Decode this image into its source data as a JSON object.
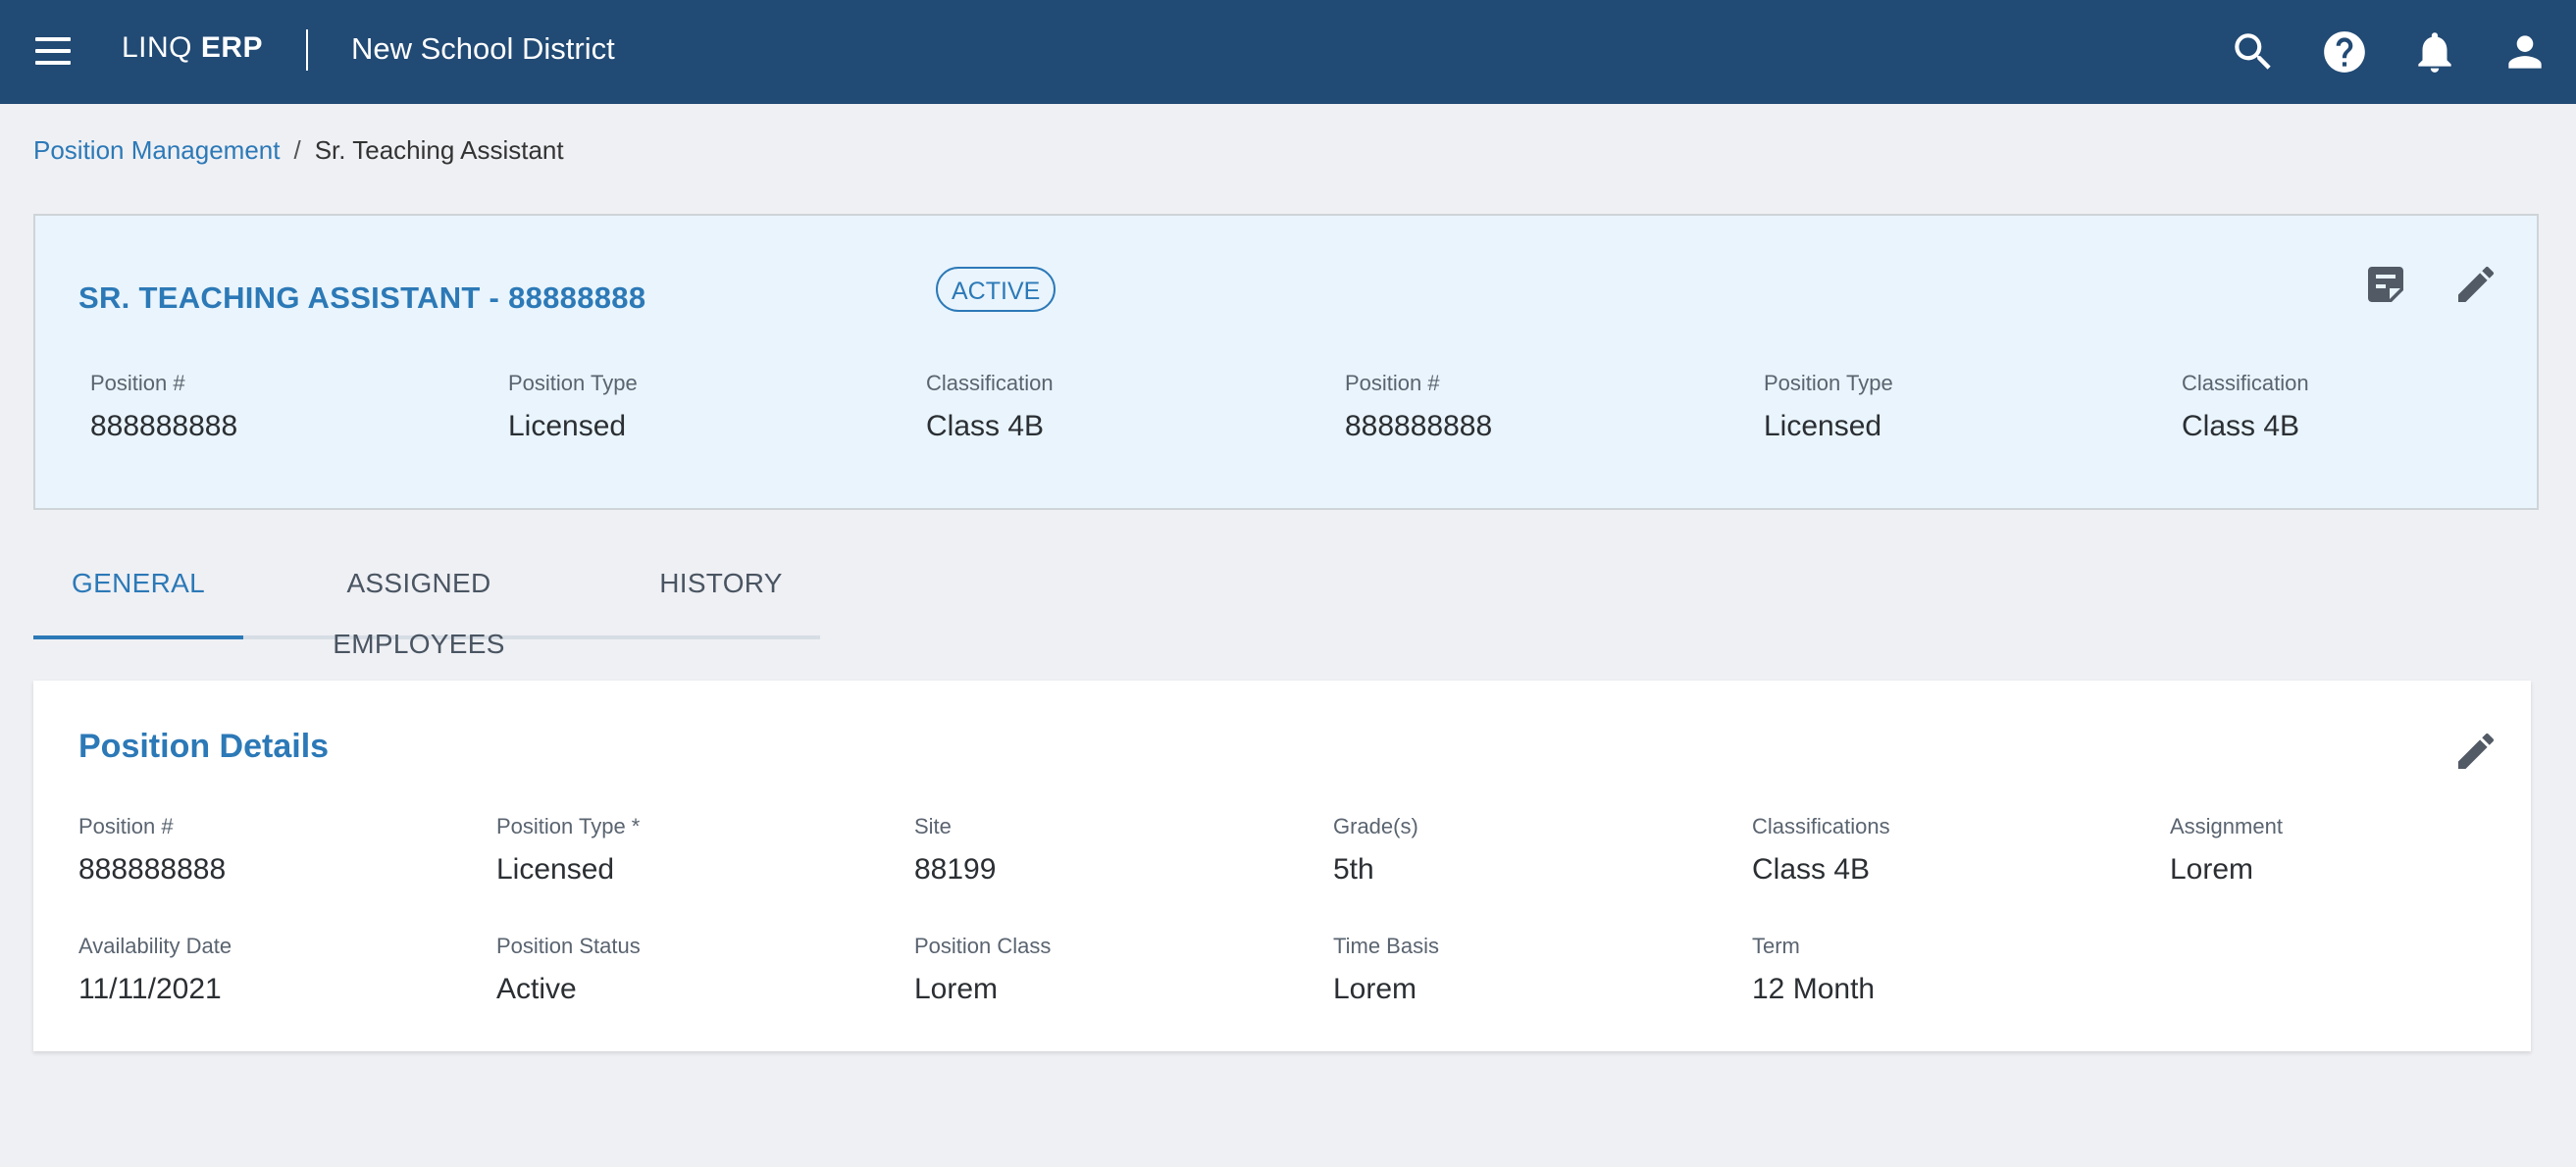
{
  "header": {
    "brand_prefix": "LINQ",
    "brand_bold": "ERP",
    "district": "New School District",
    "icons": [
      "menu-icon",
      "search-icon",
      "help-icon",
      "notifications-icon",
      "account-icon"
    ]
  },
  "breadcrumb": {
    "parent": "Position Management",
    "separator": "/",
    "current": "Sr. Teaching Assistant"
  },
  "summary": {
    "title": "SR. TEACHING ASSISTANT - 88888888",
    "status": "ACTIVE",
    "icons": [
      "notes-icon",
      "edit-icon"
    ],
    "fields": [
      {
        "label": "Position #",
        "value": "888888888"
      },
      {
        "label": "Position Type",
        "value": "Licensed"
      },
      {
        "label": "Classification",
        "value": "Class 4B"
      },
      {
        "label": "Position #",
        "value": "888888888"
      },
      {
        "label": "Position Type",
        "value": "Licensed"
      },
      {
        "label": "Classification",
        "value": "Class 4B"
      }
    ]
  },
  "tabs": [
    {
      "label": "GENERAL",
      "active": true
    },
    {
      "label": "ASSIGNED EMPLOYEES",
      "active": false
    },
    {
      "label": "HISTORY",
      "active": false
    }
  ],
  "details": {
    "title": "Position Details",
    "fields": [
      {
        "label": "Position #",
        "value": "888888888"
      },
      {
        "label": "Position Type *",
        "value": "Licensed"
      },
      {
        "label": "Site",
        "value": "88199"
      },
      {
        "label": "Grade(s)",
        "value": "5th"
      },
      {
        "label": "Classifications",
        "value": "Class 4B"
      },
      {
        "label": "Assignment",
        "value": "Lorem"
      },
      {
        "label": "Availability Date",
        "value": "11/11/2021"
      },
      {
        "label": "Position Status",
        "value": "Active"
      },
      {
        "label": "Position Class",
        "value": "Lorem"
      },
      {
        "label": "Time Basis",
        "value": "Lorem"
      },
      {
        "label": "Term",
        "value": "12 Month"
      }
    ]
  },
  "colors": {
    "header_bg": "#214a74",
    "accent": "#2c79b7",
    "page_bg": "#eff0f4",
    "summary_bg": "#e9f4fc"
  }
}
